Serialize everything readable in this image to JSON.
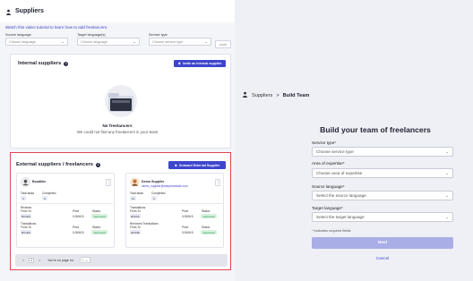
{
  "left": {
    "header": {
      "title": "Suppliers"
    },
    "tutorial_link": "Watch this video tutorial to learn how to add freelancers.",
    "filters": {
      "source": {
        "label": "Source language",
        "placeholder": "Choose language"
      },
      "target": {
        "label": "Target language(s)",
        "placeholder": "Choose language"
      },
      "service": {
        "label": "Service type",
        "placeholder": "Choose service type"
      },
      "more": "more"
    },
    "internal": {
      "title": "Internal suppliers",
      "invite_button": "Invite an internal supplier",
      "empty_title": "No freelancers",
      "empty_text": "We could not find any freelancers in your team"
    },
    "external": {
      "title": "External suppliers / freelancers",
      "onboard_button": "Onboard External Supplier",
      "cards": [
        {
          "name": "Boudklix",
          "email": "",
          "stats": {
            "total_tasks_label": "Total tasks",
            "total_tasks": "1",
            "completed_label": "Completed",
            "completed": "0"
          },
          "rows": [
            {
              "section": "Reviews",
              "from_to": "From-To",
              "pair": "RO-EN",
              "price_label": "Price",
              "price": "0.0066 $",
              "status_label": "Status",
              "status": "Approved"
            },
            {
              "section": "Translations",
              "from_to": "From-To",
              "pair": "RO-EN",
              "price_label": "Price",
              "price": "0.0066 $",
              "status_label": "Status",
              "status": "Approved"
            }
          ]
        },
        {
          "name": "Demo Supplier",
          "email": "demo_supplier@easytranslate.com",
          "stats": {
            "total_tasks_label": "Total tasks",
            "total_tasks": "11",
            "completed_label": "Completed",
            "completed": "1"
          },
          "rows": [
            {
              "section": "Translations",
              "from_to": "From-To",
              "pair": "EN-DA",
              "price_label": "Price",
              "price": "0.0066 $",
              "status_label": "Status",
              "status": "Approved"
            },
            {
              "section": "Removed Translations",
              "from_to": "From-To",
              "pair": "EN-DE",
              "price_label": "Price",
              "price": "0.0066 $",
              "status_label": "Status",
              "status": "Approved"
            }
          ]
        }
      ],
      "pager": {
        "prev": "<",
        "page": "1",
        "next": ">",
        "per_page_label": "You're on page no.",
        "per_page_value": "1"
      }
    }
  },
  "right": {
    "breadcrumb": {
      "root": "Suppliers",
      "sep": ">",
      "current": "Build Team"
    },
    "heading": "Build your team of freelancers",
    "fields": [
      {
        "label": "Service type*",
        "placeholder": "Choose service type"
      },
      {
        "label": "Area of expertise*",
        "placeholder": "Choose area of expertise"
      },
      {
        "label": "Source language*",
        "placeholder": "Select the source language"
      },
      {
        "label": "Target language*",
        "placeholder": "Select the target language"
      }
    ],
    "note": "* indicates required fields",
    "next_button": "Next",
    "cancel_link": "Cancel"
  },
  "colors": {
    "accent": "#3d46cc",
    "highlight_border": "#e0474c",
    "approved": "#1f8a48"
  }
}
